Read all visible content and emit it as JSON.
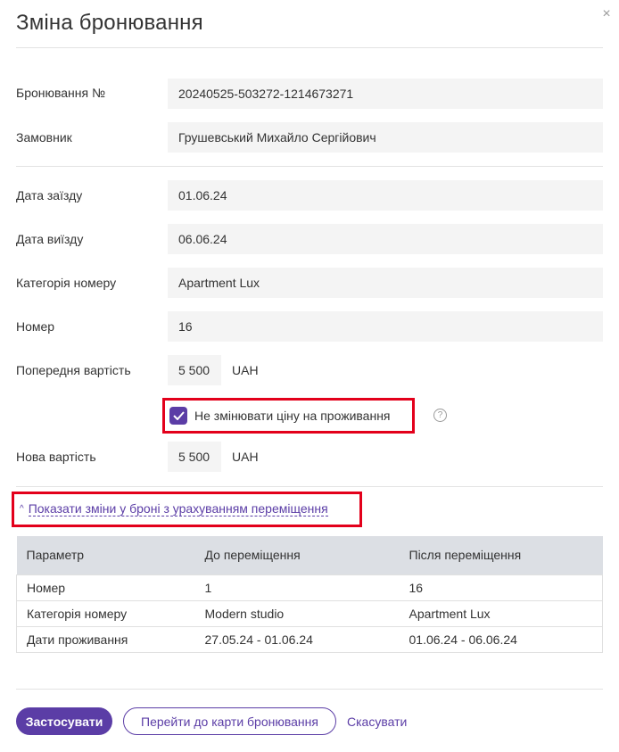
{
  "dialog": {
    "title": "Зміна бронювання",
    "close_icon": "×"
  },
  "fields": {
    "booking_no": {
      "label": "Бронювання №",
      "value": "20240525-503272-1214673271"
    },
    "customer": {
      "label": "Замовник",
      "value": "Грушевський Михайло Сергійович"
    },
    "check_in": {
      "label": "Дата заїзду",
      "value": "01.06.24"
    },
    "check_out": {
      "label": "Дата виїзду",
      "value": "06.06.24"
    },
    "room_category": {
      "label": "Категорія номеру",
      "value": "Apartment Lux"
    },
    "room": {
      "label": "Номер",
      "value": "16"
    },
    "previous_price": {
      "label": "Попередня вартість",
      "value": "5 500",
      "currency": "UAH"
    },
    "new_price": {
      "label": "Нова вартість",
      "value": "5 500",
      "currency": "UAH"
    }
  },
  "keep_price": {
    "label": "Не змінювати ціну на проживання",
    "checked": true,
    "help_icon": "?"
  },
  "changes_toggle": {
    "label": "Показати зміни у броні з урахуванням переміщення",
    "chevron": "^"
  },
  "changes_table": {
    "headers": [
      "Параметр",
      "До переміщення",
      "Після переміщення"
    ],
    "rows": [
      [
        "Номер",
        "1",
        "16"
      ],
      [
        "Категорія номеру",
        "Modern studio",
        "Apartment Lux"
      ],
      [
        "Дати проживання",
        "27.05.24 - 01.06.24",
        "01.06.24 - 06.06.24"
      ]
    ]
  },
  "footer": {
    "apply_label": "Застосувати",
    "go_to_card_label": "Перейти до карти бронювання",
    "cancel_label": "Скасувати"
  },
  "colors": {
    "accent": "#5b3da6",
    "highlight": "#e3001b",
    "field_bg": "#f4f4f4",
    "table_header_bg": "#dcdfe4"
  }
}
